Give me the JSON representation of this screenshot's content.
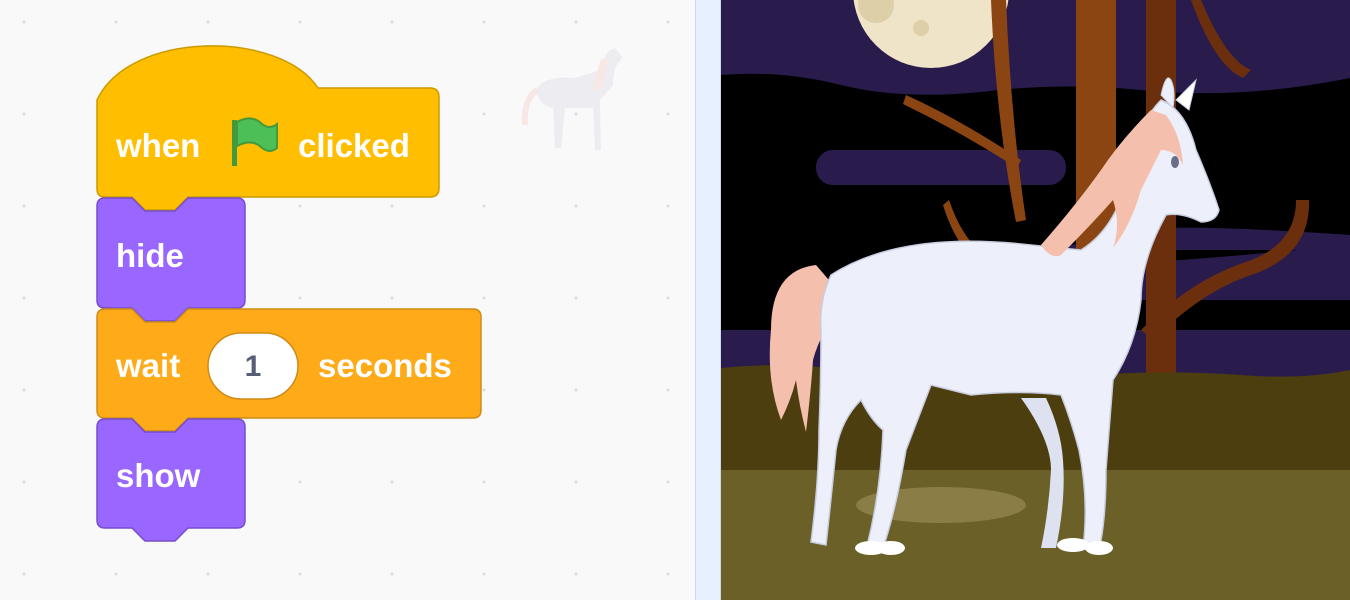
{
  "script": {
    "hat": {
      "label_before": "when",
      "label_after": "clicked",
      "icon": "green-flag-icon"
    },
    "blocks": [
      {
        "label": "hide"
      },
      {
        "label": "wait",
        "value": "1",
        "suffix": "seconds"
      },
      {
        "label": "show"
      }
    ]
  },
  "sprite": {
    "costume": "unicorn"
  },
  "colors": {
    "events": "#ffbf00",
    "looks": "#9966ff",
    "control": "#ffab19",
    "stage_sky": "#2a1b4d"
  }
}
